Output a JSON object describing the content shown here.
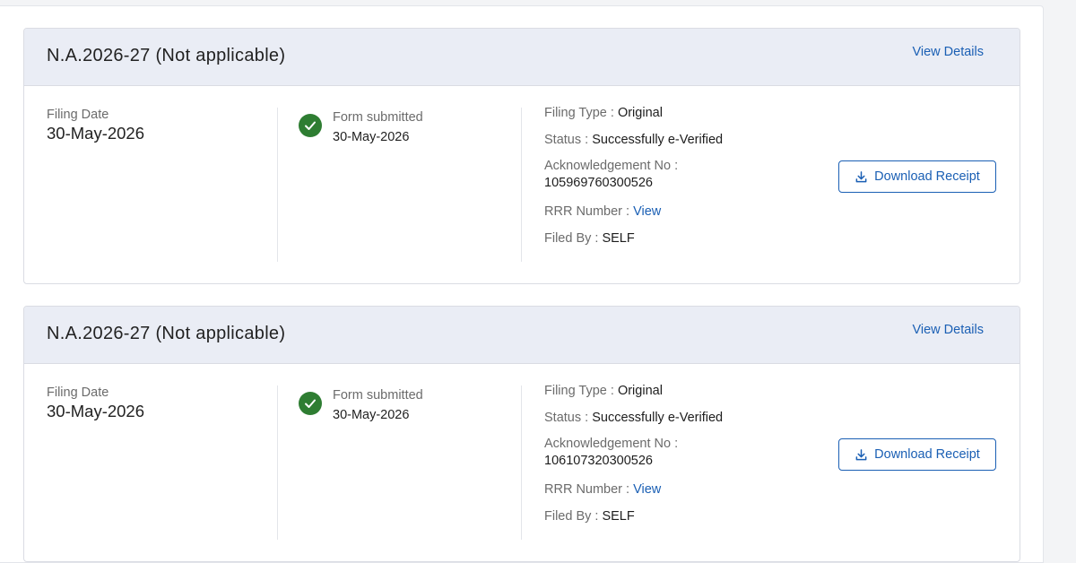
{
  "cards": [
    {
      "title": "N.A.2026-27 (Not applicable)",
      "view_details": "View Details",
      "filing_date_label": "Filing Date",
      "filing_date": "30-May-2026",
      "step_label": "Form submitted",
      "step_date": "30-May-2026",
      "filing_type_label": "Filing Type :",
      "filing_type": "Original",
      "status_label": "Status :",
      "status": "Successfully e-Verified",
      "ack_label": "Acknowledgement No :",
      "ack_no": "105969760300526",
      "rrr_label": "RRR Number :",
      "rrr_link": "View",
      "filed_by_label": "Filed By :",
      "filed_by": "SELF",
      "download_label": "Download Receipt"
    },
    {
      "title": "N.A.2026-27 (Not applicable)",
      "view_details": "View Details",
      "filing_date_label": "Filing Date",
      "filing_date": "30-May-2026",
      "step_label": "Form submitted",
      "step_date": "30-May-2026",
      "filing_type_label": "Filing Type :",
      "filing_type": "Original",
      "status_label": "Status :",
      "status": "Successfully e-Verified",
      "ack_label": "Acknowledgement No :",
      "ack_no": "106107320300526",
      "rrr_label": "RRR Number :",
      "rrr_link": "View",
      "filed_by_label": "Filed By :",
      "filed_by": "SELF",
      "download_label": "Download Receipt"
    }
  ],
  "icons": {
    "step_status": "check-circle-icon",
    "download": "download-icon"
  },
  "colors": {
    "accent": "#1a5fb4",
    "success": "#2e7d32",
    "header_bg": "#eaedf5"
  }
}
